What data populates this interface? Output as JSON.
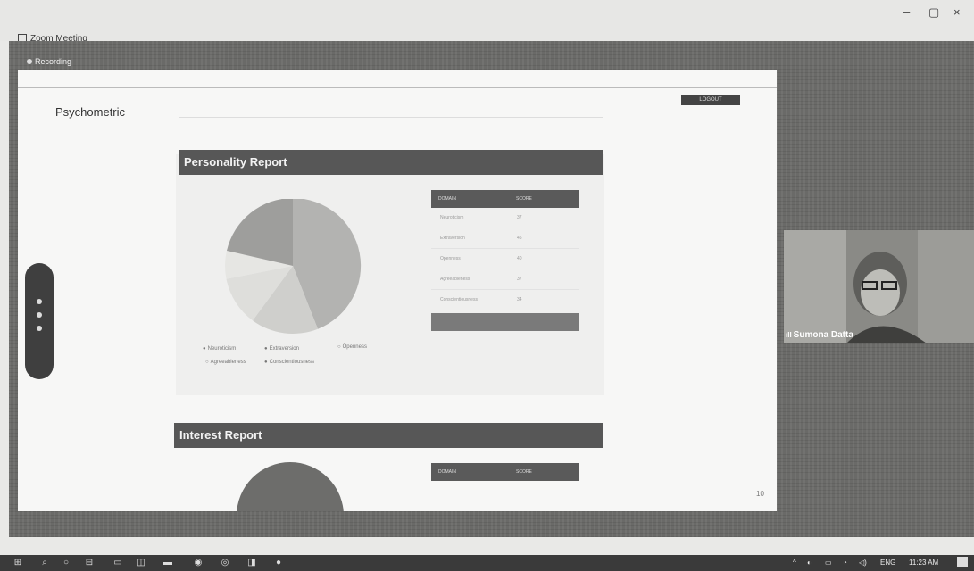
{
  "window": {
    "title": "Zoom Meeting",
    "minimize": "–",
    "maximize": "▢",
    "close": "×"
  },
  "recording": {
    "label": "Recording"
  },
  "shared_page": {
    "brand": "Psychometric",
    "logout_label": "LOGOUT",
    "page_number": "10",
    "personality_report": {
      "title": "Personality Report",
      "table_headers": [
        "DOMAIN",
        "SCORE"
      ],
      "rows": [
        {
          "domain": "Neuroticism",
          "score": "37"
        },
        {
          "domain": "Extraversion",
          "score": "45"
        },
        {
          "domain": "Openness",
          "score": "40"
        },
        {
          "domain": "Agreeableness",
          "score": "37"
        },
        {
          "domain": "Conscientiousness",
          "score": "34"
        }
      ],
      "legend": [
        "Neuroticism",
        "Extraversion",
        "Openness",
        "Agreeableness",
        "Conscientiousness"
      ]
    },
    "interest_report": {
      "title": "Interest Report",
      "table_headers": [
        "DOMAIN",
        "SCORE"
      ]
    }
  },
  "participant": {
    "name": "Sumona Datta"
  },
  "taskbar": {
    "language": "ENG",
    "time": "11:23 AM"
  }
}
